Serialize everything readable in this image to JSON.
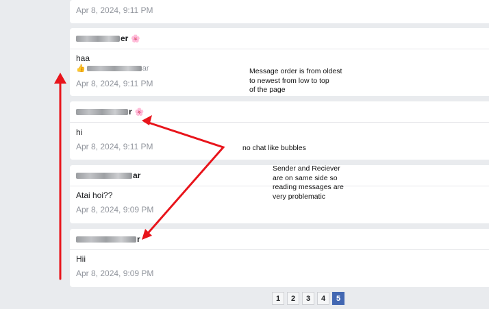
{
  "messages": [
    {
      "sender_suffix": "",
      "text": "",
      "timestamp": "Apr 8, 2024, 9:11 PM"
    },
    {
      "sender_suffix": "er",
      "flower": "🌸",
      "text": "haa",
      "reaction_suffix": "ar",
      "timestamp": "Apr 8, 2024, 9:11 PM"
    },
    {
      "sender_suffix": "r",
      "flower": "🌸",
      "text": "hi",
      "timestamp": "Apr 8, 2024, 9:11 PM"
    },
    {
      "sender_suffix": "ar",
      "text": "Atai hoi??",
      "timestamp": "Apr 8, 2024, 9:09 PM"
    },
    {
      "sender_suffix": "r",
      "text": "Hii",
      "timestamp": "Apr 8, 2024, 9:09 PM"
    }
  ],
  "annotations": {
    "order_note": [
      "Message order is from oldest",
      "to newest from low to top",
      "of the page"
    ],
    "bubbles_note": "no chat like bubbles",
    "side_note": [
      "Sender and Reciever",
      "are on same side so",
      "reading messages are",
      "very problematic"
    ]
  },
  "pagination": {
    "pages": [
      "1",
      "2",
      "3",
      "4",
      "5"
    ],
    "current": "5"
  },
  "colors": {
    "arrow": "#e8141b",
    "active_page": "#4267b2"
  }
}
